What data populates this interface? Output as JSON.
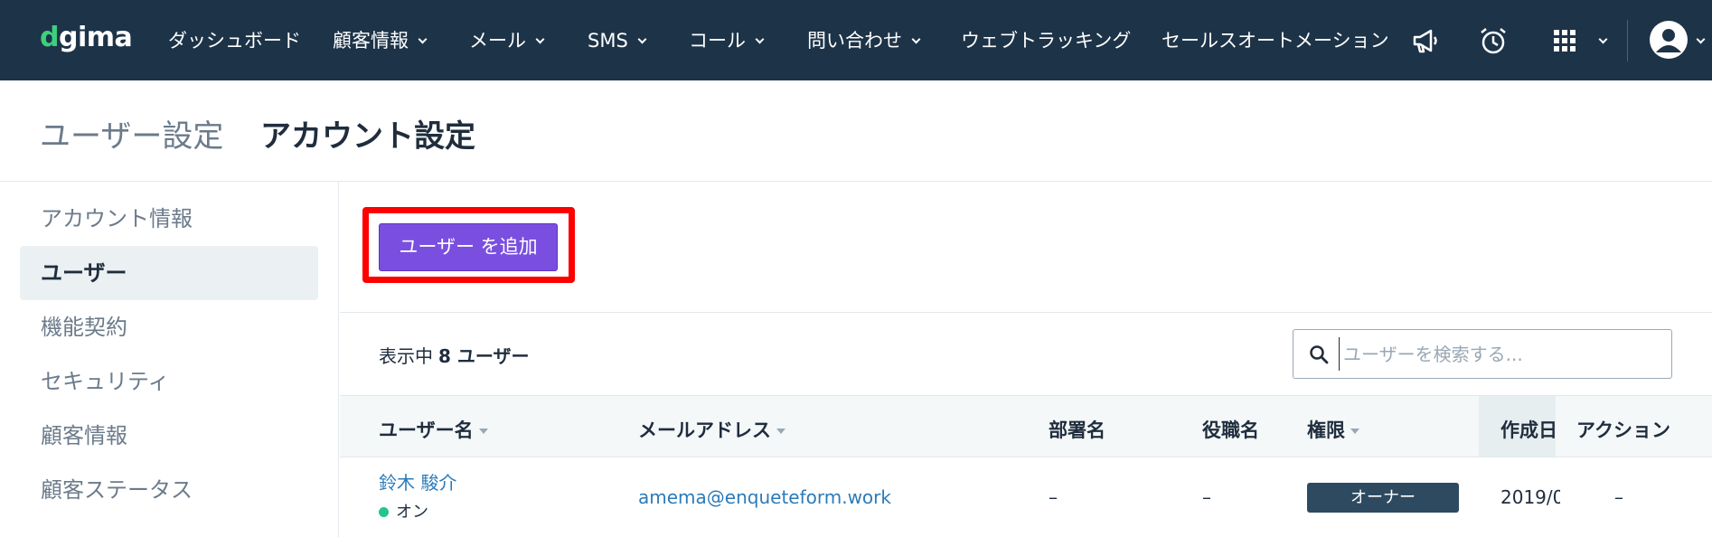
{
  "app": {
    "logo_text_pre": "d",
    "logo_text_post": "gima"
  },
  "nav": {
    "items": [
      {
        "label": "ダッシュボード",
        "has_caret": false
      },
      {
        "label": "顧客情報",
        "has_caret": true
      },
      {
        "label": "メール",
        "has_caret": true
      },
      {
        "label": "SMS",
        "has_caret": true
      },
      {
        "label": "コール",
        "has_caret": true
      },
      {
        "label": "問い合わせ",
        "has_caret": true
      },
      {
        "label": "ウェブトラッキング",
        "has_caret": false
      },
      {
        "label": "セールスオートメーション",
        "has_caret": false
      }
    ],
    "icons": [
      "megaphone-icon",
      "alarm-clock-icon",
      "apps-grid-icon",
      "user-avatar-icon"
    ]
  },
  "header": {
    "parent": "ユーザー設定",
    "current": "アカウント設定"
  },
  "sidebar": {
    "items": [
      {
        "label": "アカウント情報",
        "active": false
      },
      {
        "label": "ユーザー",
        "active": true
      },
      {
        "label": "機能契約",
        "active": false
      },
      {
        "label": "セキュリティ",
        "active": false
      },
      {
        "label": "顧客情報",
        "active": false
      },
      {
        "label": "顧客ステータス",
        "active": false
      }
    ]
  },
  "main": {
    "add_button": "ユーザー を追加",
    "count_prefix": "表示中",
    "count_value": "8 ユーザー",
    "search_placeholder": "ユーザーを検索する...",
    "columns": {
      "name": "ユーザー名",
      "email": "メールアドレス",
      "department": "部署名",
      "title": "役職名",
      "role": "権限",
      "created": "作成日",
      "action": "アクション"
    },
    "rows": [
      {
        "name": "鈴木 駿介",
        "status": "オン",
        "email": "amema@enqueteform.work",
        "department": "–",
        "title": "–",
        "role": "オーナー",
        "created": "2019/0",
        "action": "–"
      }
    ]
  },
  "colors": {
    "nav_bg": "#1d3348",
    "accent_button": "#7a4fe0",
    "highlight_border": "#ff0000",
    "link": "#2b7bb9",
    "status_on": "#22c58b",
    "badge_bg": "#2e4a60"
  }
}
